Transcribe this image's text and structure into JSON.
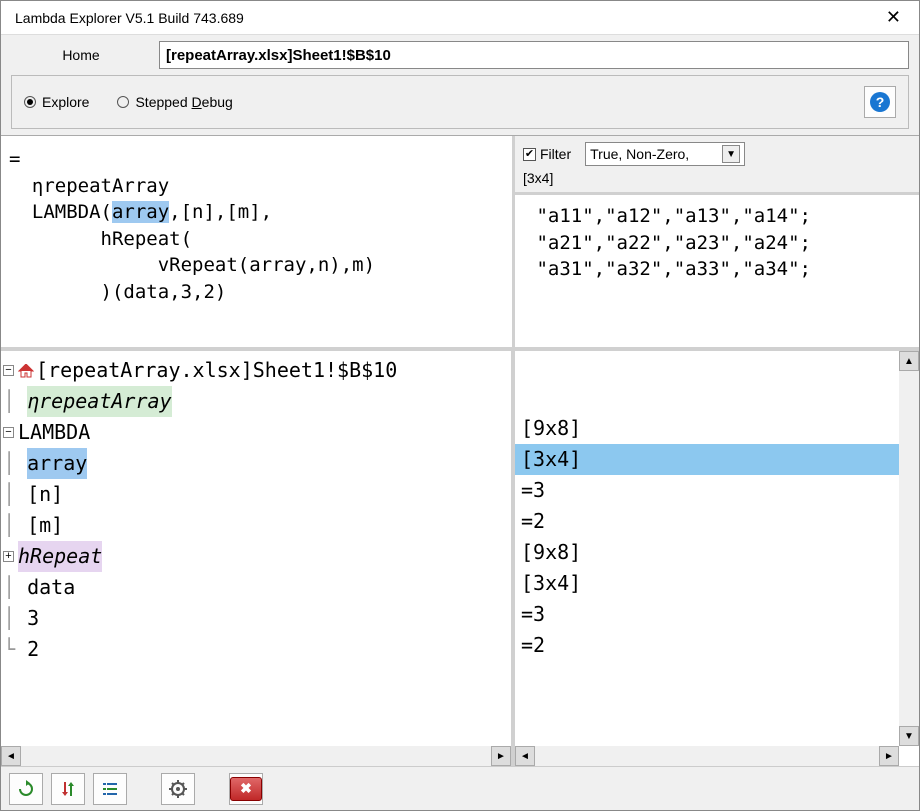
{
  "window": {
    "title": "Lambda Explorer V5.1 Build 743.689"
  },
  "header": {
    "home_label": "Home",
    "reference": "[repeatArray.xlsx]Sheet1!$B$10"
  },
  "mode": {
    "explore_label": "Explore",
    "debug_prefix": "Stepped ",
    "debug_underline": "D",
    "debug_suffix": "ebug",
    "selected": "explore"
  },
  "formula": {
    "line1": "= ",
    "line2": "  ηrepeatArray ",
    "line3a": "  LAMBDA(",
    "line3b": "array",
    "line3c": ",[n],[m], ",
    "line4": "        hRepeat( ",
    "line5": "             vRepeat(array,n),m) ",
    "line6": "        )(data,3,2)"
  },
  "filter": {
    "checkbox_label": "Filter",
    "checked": true,
    "dropdown_value": "True, Non-Zero,",
    "dims": "[3x4]"
  },
  "array_lines": [
    " \"a11\",\"a12\",\"a13\",\"a14\";",
    " \"a21\",\"a22\",\"a23\",\"a24\";",
    " \"a31\",\"a32\",\"a33\",\"a34\";"
  ],
  "tree": {
    "root": "[repeatArray.xlsx]Sheet1!$B$10",
    "repeatFn": "ηrepeatArray",
    "lambda": "LAMBDA",
    "array": "array",
    "n": "[n]",
    "m": "[m]",
    "hrepeat": "hRepeat",
    "data": "data",
    "three": "3",
    "two": "2"
  },
  "values": [
    {
      "text": "[9x8]",
      "selected": false
    },
    {
      "text": "[3x4]",
      "selected": true
    },
    {
      "text": "=3",
      "selected": false
    },
    {
      "text": "=2",
      "selected": false
    },
    {
      "text": "[9x8]",
      "selected": false
    },
    {
      "text": "[3x4]",
      "selected": false
    },
    {
      "text": "=3",
      "selected": false
    },
    {
      "text": "=2",
      "selected": false
    }
  ]
}
